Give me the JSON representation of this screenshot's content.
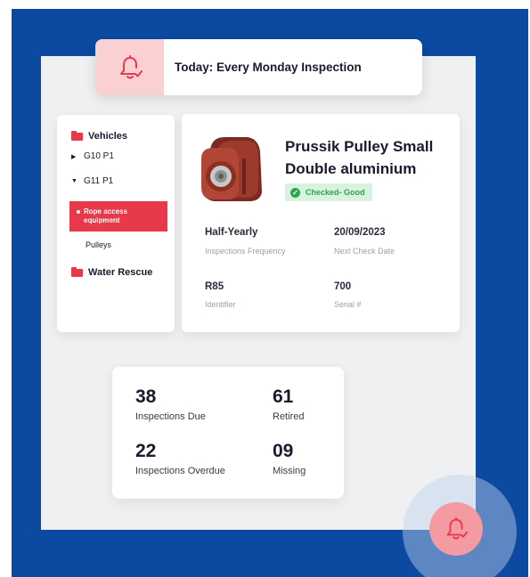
{
  "colors": {
    "brand_blue": "#0b4aa0",
    "accent_red": "#e8394a",
    "badge_green": "#2ea44f",
    "banner_icon_bg": "#fbd0d3",
    "fab_bg": "#f39aa3"
  },
  "banner": {
    "icon": "bell-check-icon",
    "text": "Today: Every Monday Inspection"
  },
  "sidebar": {
    "items": [
      {
        "label": "Vehicles",
        "icon": "folder-icon",
        "level": 0
      },
      {
        "label": "G10 P1",
        "icon": "caret-right-icon",
        "level": 1
      },
      {
        "label": "G11 P1",
        "icon": "caret-down-icon",
        "level": 1
      },
      {
        "label_line1": "Rope access",
        "label_line2": "equipment",
        "level": 2,
        "active": true
      },
      {
        "label": "Pulleys",
        "level": 2
      },
      {
        "label": "Water Rescue",
        "icon": "folder-icon",
        "level": 0
      }
    ]
  },
  "detail": {
    "title_line1": "Prussik Pulley Small",
    "title_line2": "Double aluminium",
    "status": "Checked- Good",
    "fields": {
      "frequency_value": "Half-Yearly",
      "frequency_label": "Inspections Frequency",
      "next_check_value": "20/09/2023",
      "next_check_label": "Next Check Date",
      "identifier_value": "R85",
      "identifier_label": "Identifier",
      "serial_value": "700",
      "serial_label": "Serial #"
    }
  },
  "stats": {
    "due_value": "38",
    "due_label": "Inspections Due",
    "retired_value": "61",
    "retired_label": "Retired",
    "overdue_value": "22",
    "overdue_label": "Inspections Overdue",
    "missing_value": "09",
    "missing_label": "Missing"
  },
  "fab": {
    "icon": "bell-check-icon"
  }
}
